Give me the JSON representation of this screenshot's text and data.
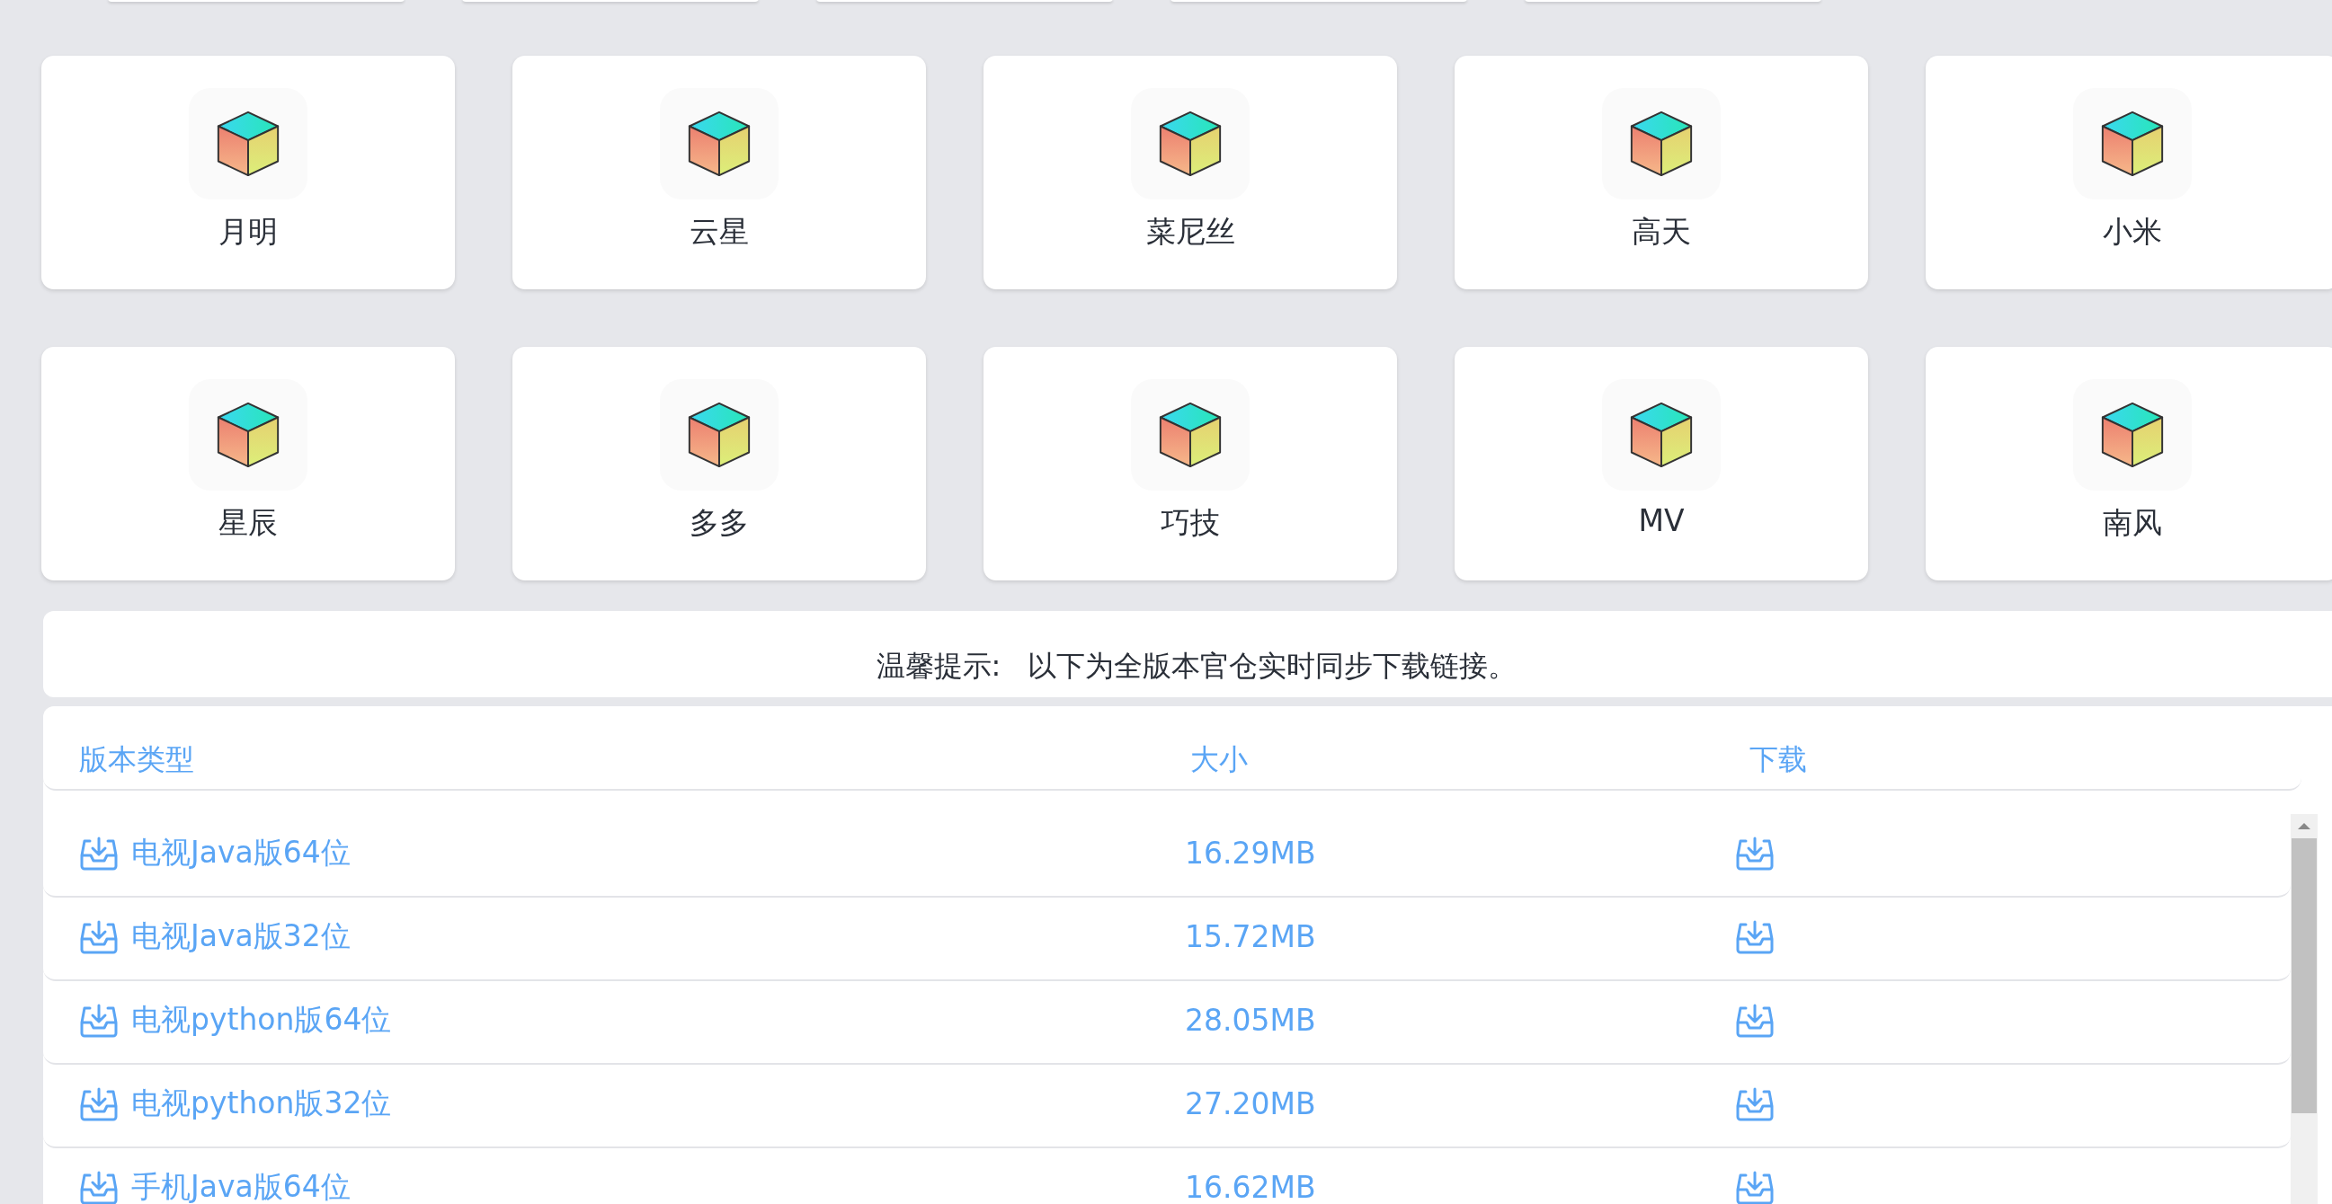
{
  "apps": [
    [
      {
        "name": "月明"
      },
      {
        "name": "云星"
      },
      {
        "name": "菜尼丝"
      },
      {
        "name": "高天"
      },
      {
        "name": "小米"
      }
    ],
    [
      {
        "name": "星辰"
      },
      {
        "name": "多多"
      },
      {
        "name": "巧技"
      },
      {
        "name": "MV"
      },
      {
        "name": "南风"
      }
    ]
  ],
  "notice": {
    "label": "温馨提示:",
    "text": "以下为全版本官仓实时同步下载链接。"
  },
  "table": {
    "columns": [
      "版本类型",
      "大小",
      "下载"
    ],
    "rows": [
      {
        "name": "电视Java版64位",
        "size": "16.29MB"
      },
      {
        "name": "电视Java版32位",
        "size": "15.72MB"
      },
      {
        "name": "电视python版64位",
        "size": "28.05MB"
      },
      {
        "name": "电视python版32位",
        "size": "27.20MB"
      },
      {
        "name": "手机Java版64位",
        "size": "16.62MB"
      }
    ]
  }
}
